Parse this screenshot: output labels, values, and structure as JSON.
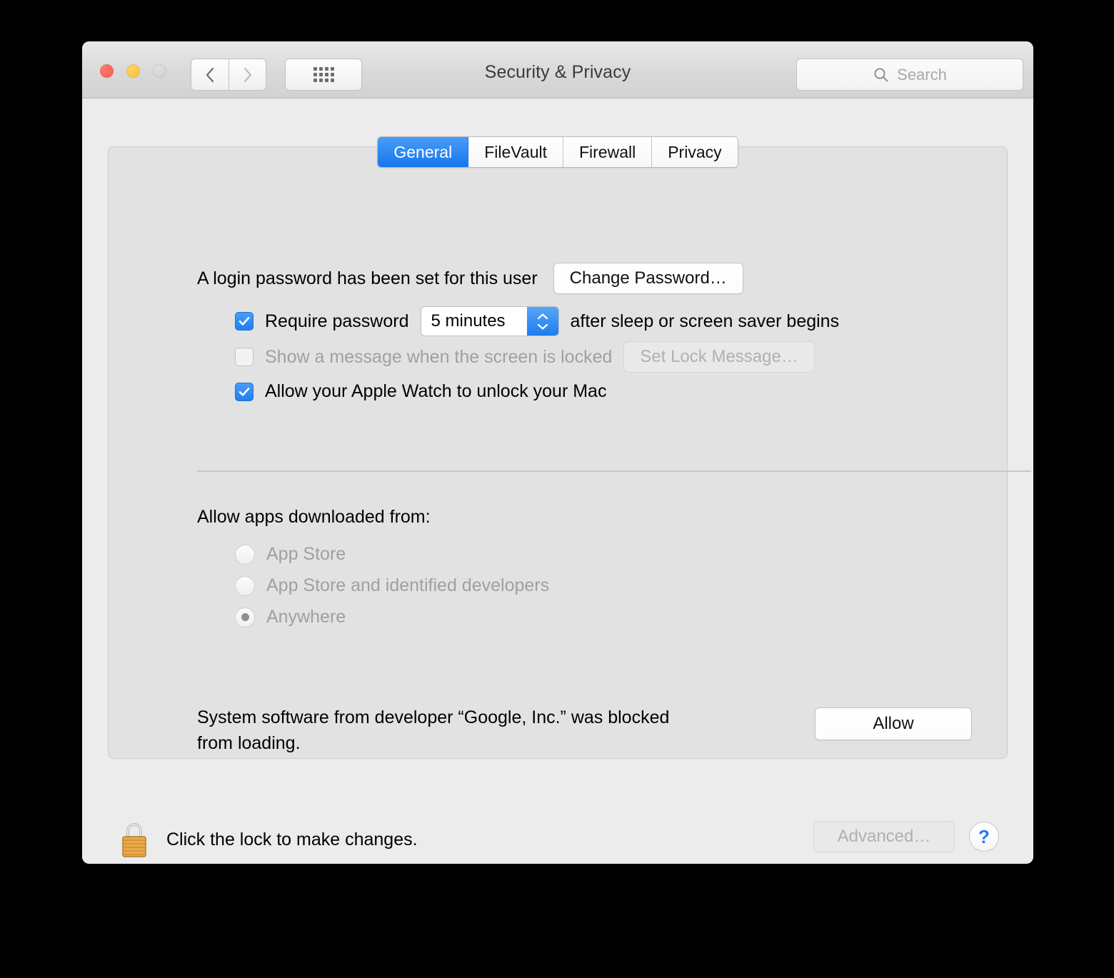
{
  "window": {
    "title": "Security & Privacy",
    "traffic_lights": [
      "close",
      "minimize",
      "zoom"
    ],
    "nav": {
      "back_label": "Back",
      "forward_label": "Forward",
      "show_all_label": "Show All"
    },
    "search": {
      "placeholder": "Search",
      "value": ""
    }
  },
  "tabs": [
    {
      "label": "General",
      "active": true
    },
    {
      "label": "FileVault",
      "active": false
    },
    {
      "label": "Firewall",
      "active": false
    },
    {
      "label": "Privacy",
      "active": false
    }
  ],
  "general": {
    "login_password_text": "A login password has been set for this user",
    "change_password_button": "Change Password…",
    "require_password": {
      "label": "Require password",
      "checked": true,
      "delay_value": "5 minutes",
      "suffix": "after sleep or screen saver begins"
    },
    "lock_message": {
      "label": "Show a message when the screen is locked",
      "checked": false,
      "button": "Set Lock Message…",
      "enabled": false
    },
    "apple_watch": {
      "label": "Allow your Apple Watch to unlock your Mac",
      "checked": true
    },
    "gatekeeper": {
      "heading": "Allow apps downloaded from:",
      "enabled": false,
      "options": [
        {
          "label": "App Store",
          "selected": false
        },
        {
          "label": "App Store and identified developers",
          "selected": false
        },
        {
          "label": "Anywhere",
          "selected": true
        }
      ]
    },
    "blocked_notice": {
      "line1": "System software from developer “Google, Inc.” was blocked",
      "line2": "from loading.",
      "allow_button": "Allow"
    }
  },
  "footer": {
    "lock_text": "Click the lock to make changes.",
    "lock_state": "locked",
    "advanced_button": "Advanced…",
    "advanced_enabled": false,
    "help_button": "?"
  },
  "colors": {
    "accent_blue": "#1f7ff1",
    "window_bg": "#ececec",
    "panel_bg": "#e2e2e2",
    "disabled_text": "#a0a0a0",
    "title_text": "#3b3b3b"
  }
}
